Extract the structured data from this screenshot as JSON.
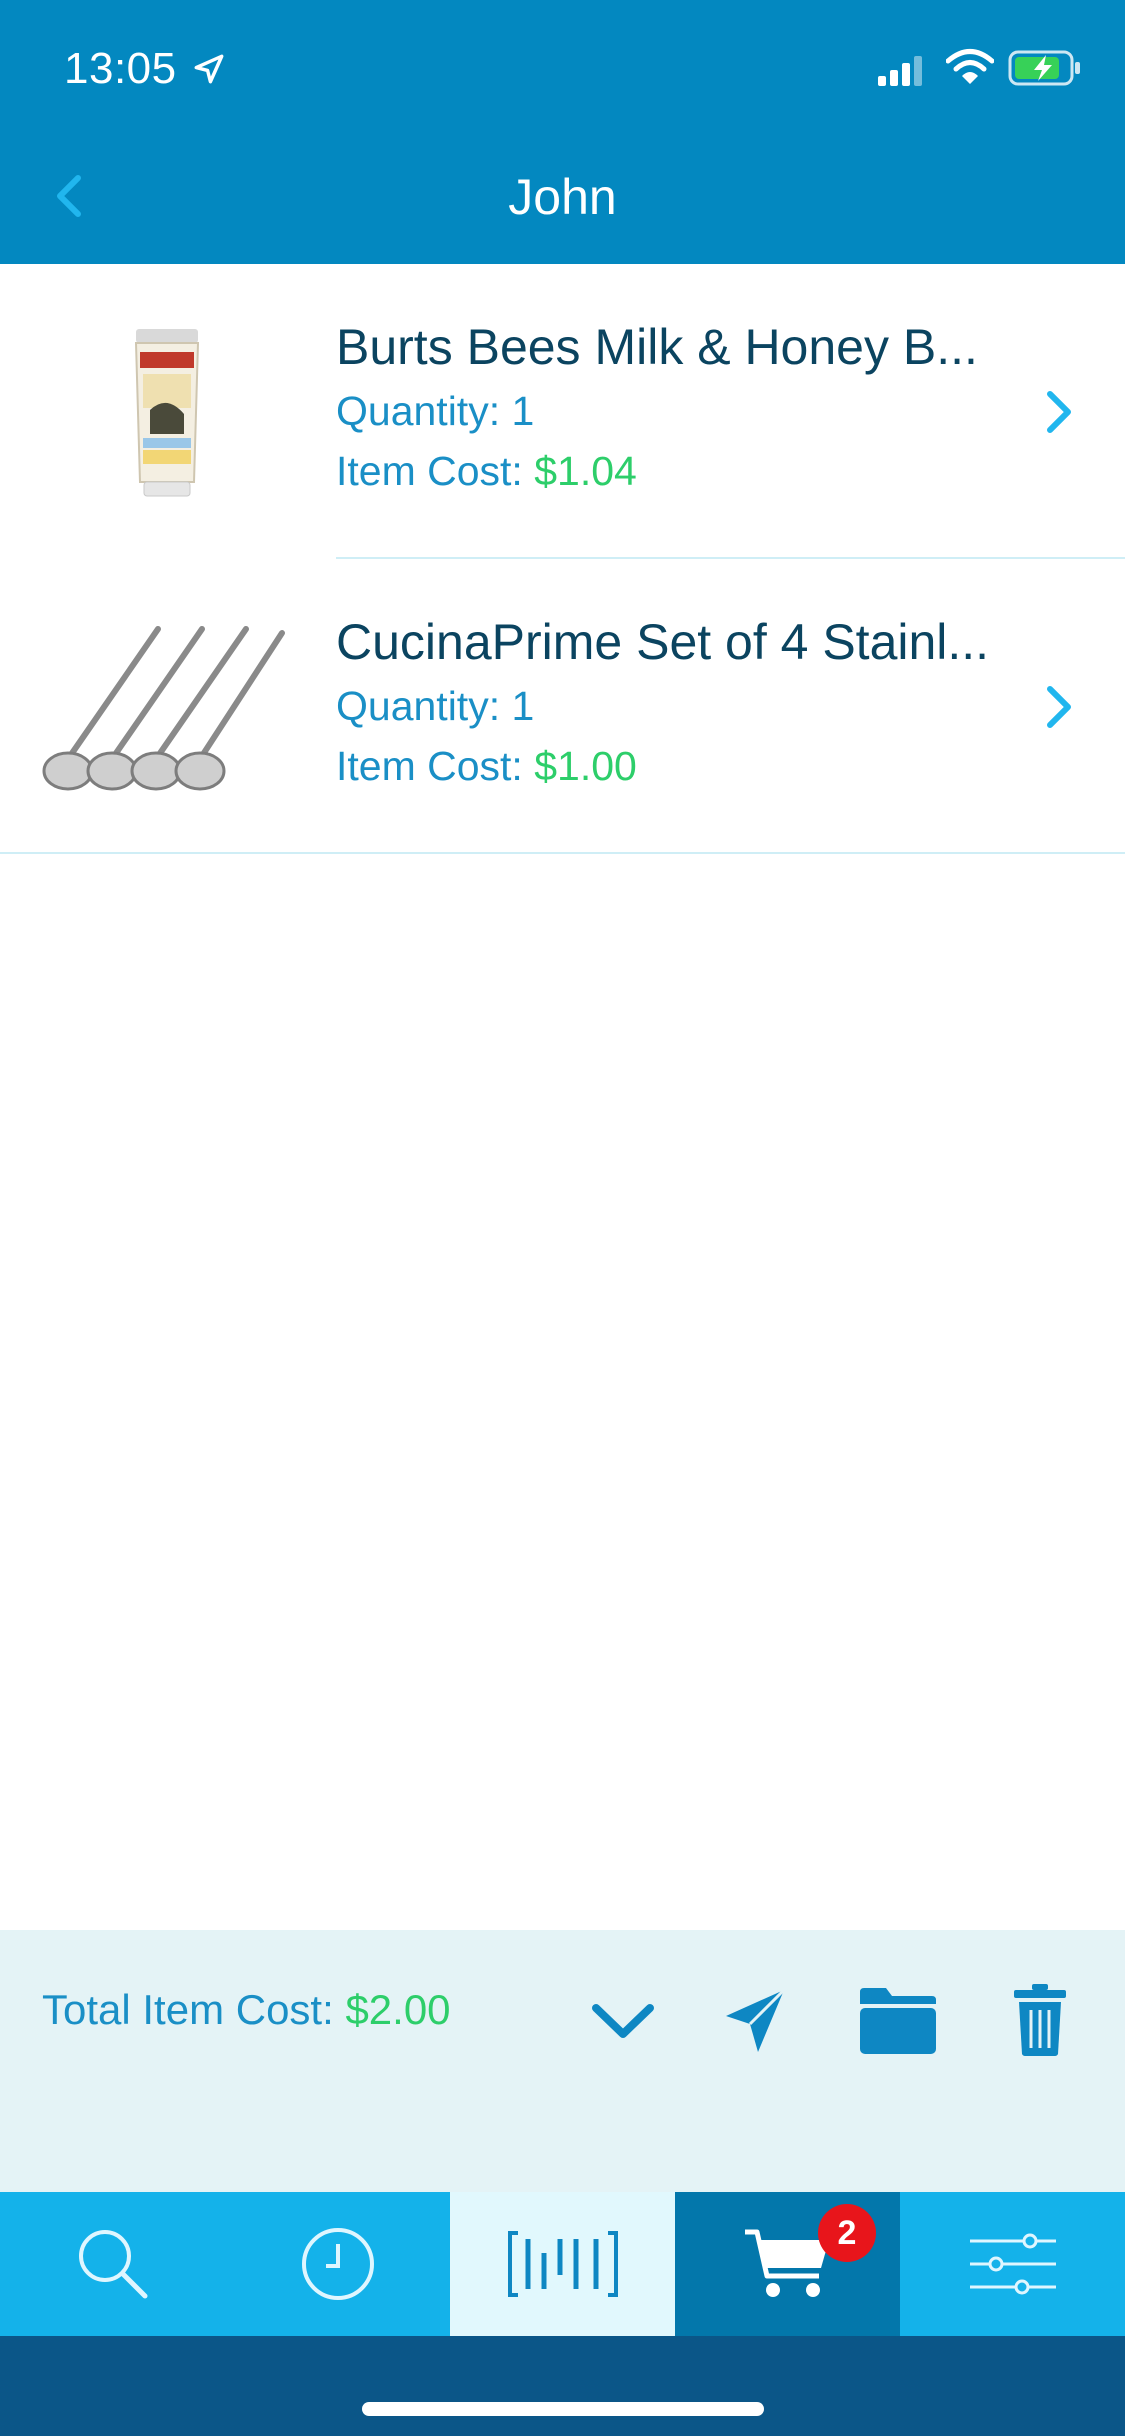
{
  "status_bar": {
    "time": "13:05"
  },
  "nav": {
    "title": "John",
    "back_icon": "chevron-left-icon"
  },
  "items": [
    {
      "title": "Burts Bees Milk & Honey B...",
      "quantity": "Quantity: 1",
      "cost_label": "Item Cost: ",
      "cost_value": "$1.04",
      "thumb_icon": "lotion-tube-image"
    },
    {
      "title": "CucinaPrime Set of 4 Stainl...",
      "quantity": "Quantity: 1",
      "cost_label": "Item Cost: ",
      "cost_value": "$1.00",
      "thumb_icon": "ladles-image"
    }
  ],
  "summary": {
    "total_label": "Total Item Cost: ",
    "total_value": "$2.00",
    "actions": [
      "chevron-down-icon",
      "send-icon",
      "folder-icon",
      "trash-icon"
    ]
  },
  "tabbar": {
    "tabs": [
      "search-icon",
      "clock-icon",
      "barcode-icon",
      "cart-icon",
      "sliders-icon"
    ],
    "cart_badge": "2"
  },
  "colors": {
    "header": "#0388c0",
    "accent": "#1a8fc6",
    "price": "#2dce6a",
    "tabbar": "#14b2ea",
    "tab_active": "#0377ab",
    "badge": "#e8151b"
  }
}
